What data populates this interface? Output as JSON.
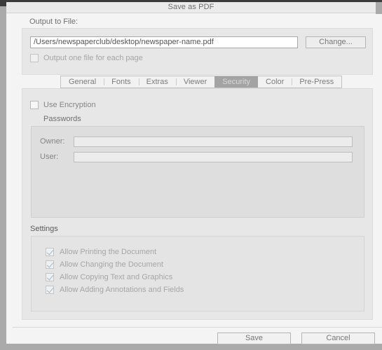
{
  "window": {
    "title": "Save as PDF"
  },
  "output": {
    "section_label": "Output to File:",
    "path_value": "/Users/newspaperclub/desktop/newspaper-name.pdf",
    "path_placeholder": "",
    "change_label": "Change...",
    "one_file_per_page": {
      "label": "Output one file for each page",
      "checked": false,
      "enabled": false
    }
  },
  "tabs": {
    "selected": "Security",
    "items": [
      {
        "label": "General"
      },
      {
        "label": "Fonts"
      },
      {
        "label": "Extras"
      },
      {
        "label": "Viewer"
      },
      {
        "label": "Security"
      },
      {
        "label": "Color"
      },
      {
        "label": "Pre-Press"
      }
    ]
  },
  "security": {
    "use_encryption": {
      "label": "Use Encryption",
      "checked": false,
      "enabled": true
    },
    "passwords_label": "Passwords",
    "fields": [
      {
        "label": "Owner:",
        "value": "",
        "placeholder": ""
      },
      {
        "label": "User:",
        "value": "",
        "placeholder": ""
      }
    ],
    "settings_label": "Settings",
    "settings": [
      {
        "label": "Allow Printing the Document",
        "checked": true,
        "enabled": false
      },
      {
        "label": "Allow Changing the Document",
        "checked": true,
        "enabled": false
      },
      {
        "label": "Allow Copying Text and Graphics",
        "checked": true,
        "enabled": false
      },
      {
        "label": "Allow Adding Annotations and Fields",
        "checked": true,
        "enabled": false
      }
    ]
  },
  "footer": {
    "save_label": "Save",
    "cancel_label": "Cancel"
  },
  "colors": {
    "window_bg": "#f4f4f4",
    "panel_bg": "#e7e7e7",
    "frame_border": "#aaaaaa",
    "selected_tab_bg": "#a3a3a3",
    "selected_tab_text": "#d8d8d8",
    "check_mark": "#9fb8cc",
    "text": "#6f6f6f"
  }
}
